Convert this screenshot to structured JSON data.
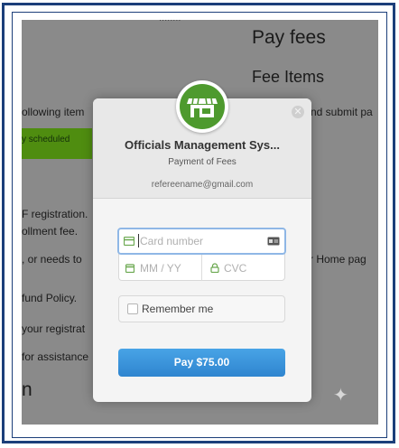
{
  "background_page": {
    "top_fragment": "........",
    "heading": "Pay fees",
    "subheading": "Fee Items",
    "left_fragments": [
      "ollowing item",
      "F registration.",
      "ollment fee.",
      ", or needs to",
      "fund Policy.",
      "your registrat",
      "for assistance",
      "n"
    ],
    "right_fragments": [
      "nd submit pa",
      "r Home pag"
    ],
    "status_badge": "y scheduled",
    "badge_color": "#4f8d10"
  },
  "modal": {
    "title": "Officials Management Sys...",
    "subtitle": "Payment of Fees",
    "email": "refereename@gmail.com",
    "close_icon": "close-icon",
    "logo_icon": "storefront-icon",
    "card_number_placeholder": "Card number",
    "expiry_placeholder": "MM / YY",
    "cvc_placeholder": "CVC",
    "remember_label": "Remember me",
    "remember_checked": false,
    "pay_button": "Pay $75.00",
    "accent_color": "#4e9a2e",
    "button_color": "#3a93da"
  }
}
